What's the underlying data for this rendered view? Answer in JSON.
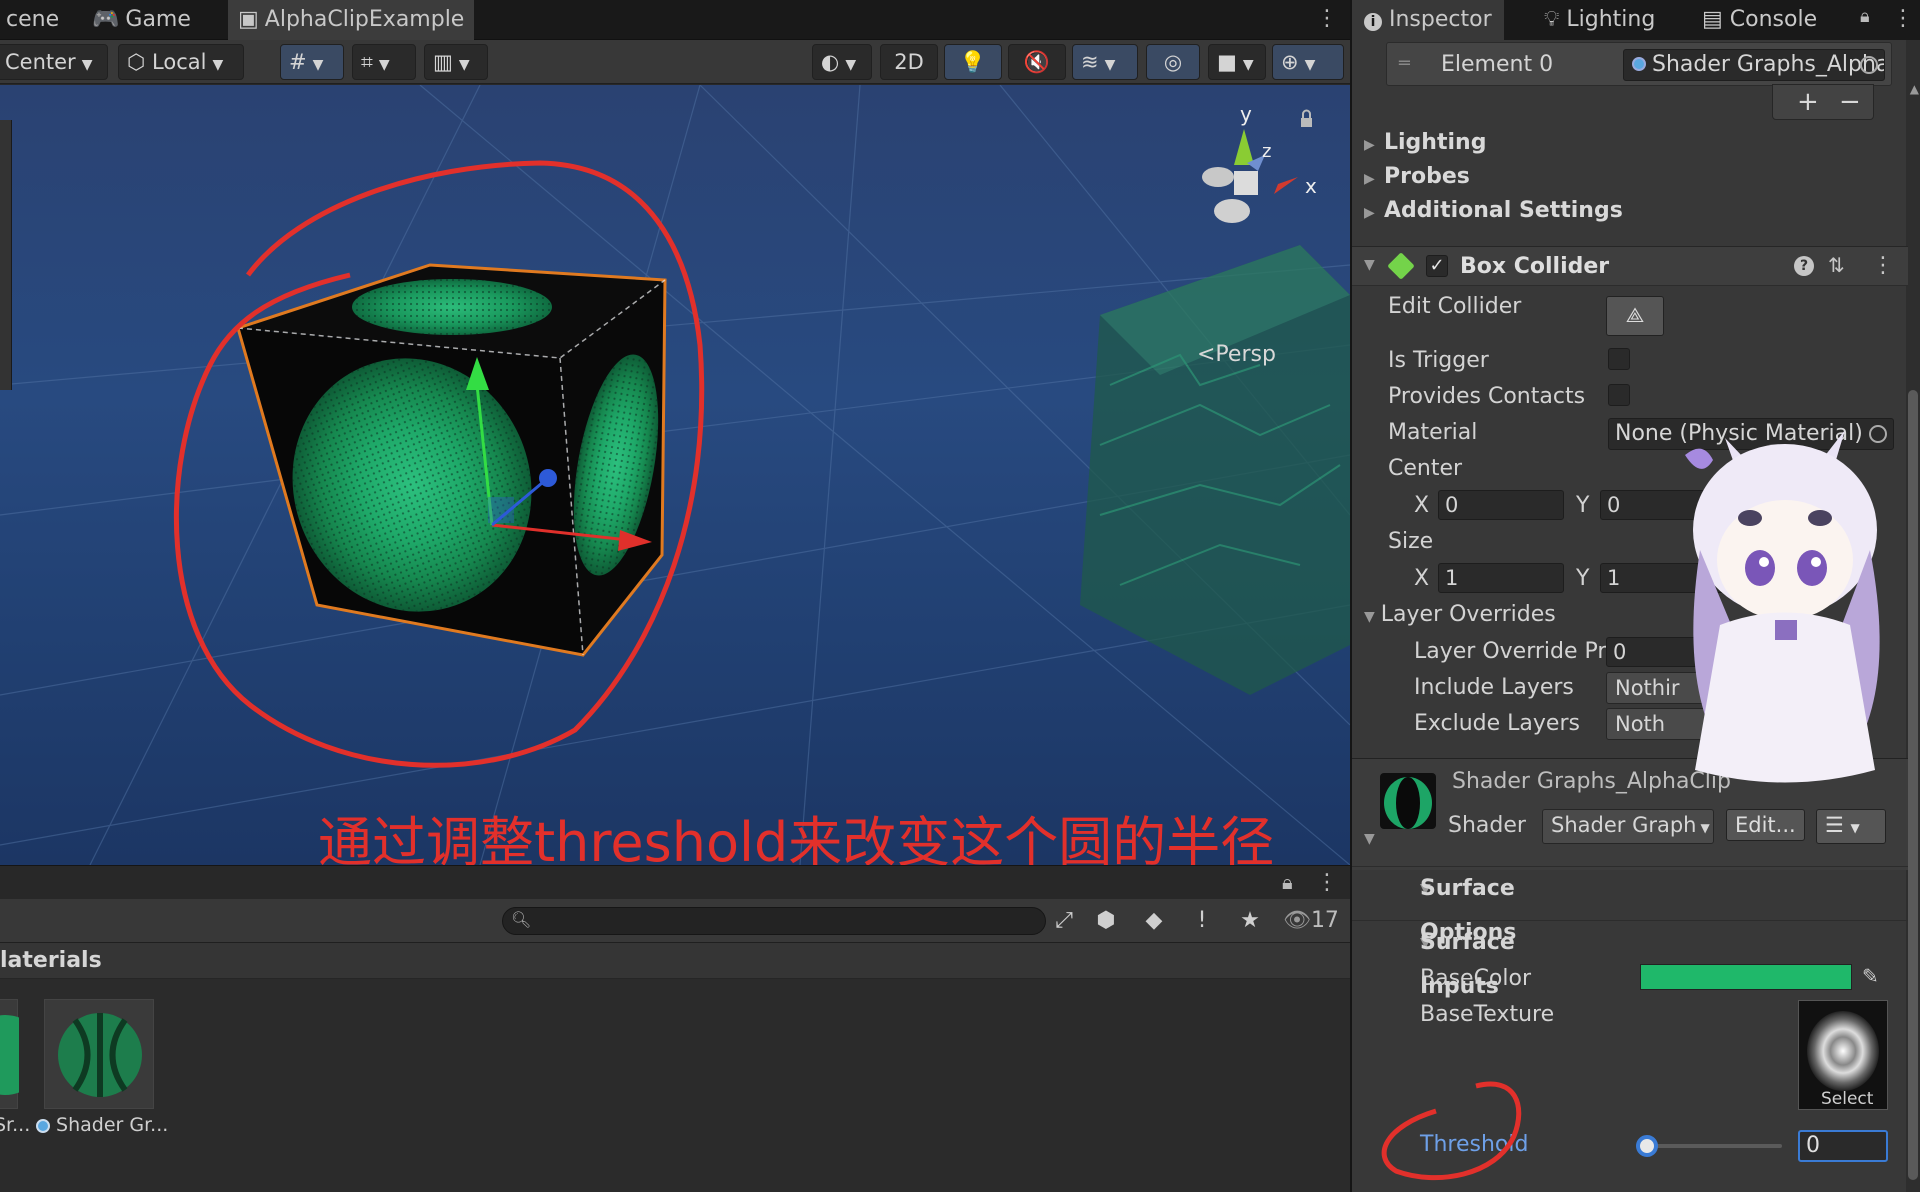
{
  "scene_tabs": [
    {
      "label": "cene"
    },
    {
      "label": "Game"
    },
    {
      "label": "AlphaClipExample"
    }
  ],
  "scene_toolbar": {
    "pivot_label": "Center",
    "space_label": "Local",
    "mode_2d_label": "2D"
  },
  "viewport": {
    "caption": "通过调整threshold来改变这个圆的半径",
    "projection_label": "<Persp",
    "gizmo_axes": {
      "x": "x",
      "y": "y",
      "z": "z"
    }
  },
  "project": {
    "folder_label": "laterials",
    "count": "17",
    "assets": [
      {
        "label": "Sr..."
      },
      {
        "label": "Shader Gr..."
      }
    ]
  },
  "inspector_tabs": [
    {
      "label": "Inspector"
    },
    {
      "label": "Lighting"
    },
    {
      "label": "Console"
    }
  ],
  "inspector": {
    "element_label": "Element 0",
    "element_value": "Shader Graphs_AlphaC",
    "foldouts": {
      "lighting": "Lighting",
      "probes": "Probes",
      "additional": "Additional Settings"
    },
    "box_collider": {
      "title": "Box Collider",
      "edit_collider": "Edit Collider",
      "is_trigger": "Is Trigger",
      "provides_contacts": "Provides Contacts",
      "material_label": "Material",
      "material_value": "None (Physic Material)",
      "center_label": "Center",
      "center": {
        "x_label": "X",
        "x": "0",
        "y_label": "Y",
        "y": "0"
      },
      "size_label": "Size",
      "size": {
        "x_label": "X",
        "x": "1",
        "y_label": "Y",
        "y": "1"
      },
      "layer_overrides": "Layer Overrides",
      "layer_priority_label": "Layer Override Pri",
      "layer_priority": "0",
      "include_layers_label": "Include Layers",
      "include_layers": "Nothir",
      "exclude_layers_label": "Exclude Layers",
      "exclude_layers": "Noth"
    },
    "material": {
      "name": "Shader Graphs_AlphaClip",
      "shader_label": "Shader",
      "shader_value": "Shader Graph",
      "edit_label": "Edit...",
      "surface_options": "Surface Options",
      "surface_inputs": "Surface Inputs",
      "base_color_label": "BaseColor",
      "base_color": "#1fb86a",
      "base_texture_label": "BaseTexture",
      "select_label": "Select",
      "threshold_label": "Threshold",
      "threshold_value": "0"
    }
  },
  "colors": {
    "annotation_red": "#e2302b",
    "accent_blue": "#3a7bd5",
    "cube_green": "#1fa865"
  }
}
